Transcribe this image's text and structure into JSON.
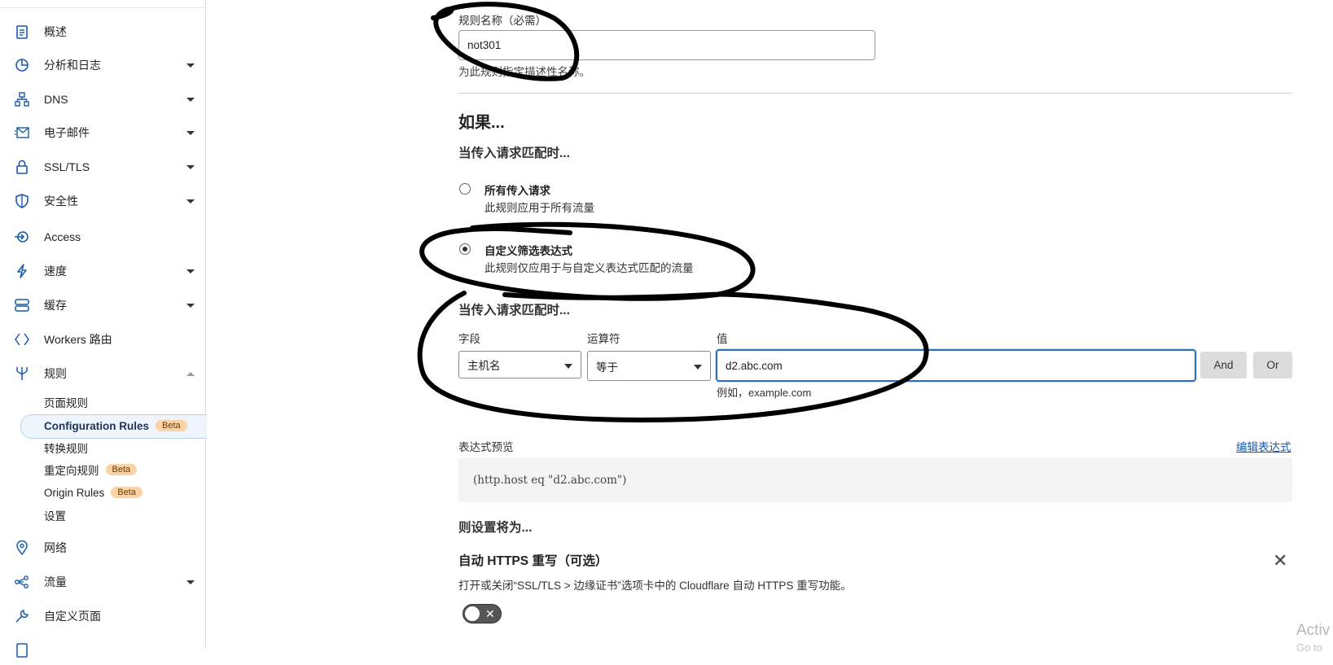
{
  "sidebar": {
    "items": [
      {
        "label": "概述",
        "icon": "clipboard-icon",
        "caret": false
      },
      {
        "label": "分析和日志",
        "icon": "pie-chart-icon",
        "caret": true
      },
      {
        "label": "DNS",
        "icon": "network-tree-icon",
        "caret": true
      },
      {
        "label": "电子邮件",
        "icon": "email-icon",
        "caret": true
      },
      {
        "label": "SSL/TLS",
        "icon": "lock-icon",
        "caret": true
      },
      {
        "label": "安全性",
        "icon": "shield-icon",
        "caret": true
      },
      {
        "label": "Access",
        "icon": "access-arrow-icon",
        "caret": false
      },
      {
        "label": "速度",
        "icon": "lightning-icon",
        "caret": true
      },
      {
        "label": "缓存",
        "icon": "server-stack-icon",
        "caret": true
      },
      {
        "label": "Workers 路由",
        "icon": "workers-icon",
        "caret": false
      },
      {
        "label": "规则",
        "icon": "fork-icon",
        "caret": "up"
      },
      {
        "label": "网络",
        "icon": "location-pin-icon",
        "caret": false
      },
      {
        "label": "流量",
        "icon": "traffic-nodes-icon",
        "caret": true
      },
      {
        "label": "自定义页面",
        "icon": "wrench-icon",
        "caret": false
      }
    ],
    "rules_sub": [
      {
        "label": "页面规则",
        "badge": ""
      },
      {
        "label": "Configuration Rules",
        "badge": "Beta",
        "active": true
      },
      {
        "label": "转换规则",
        "badge": ""
      },
      {
        "label": "重定向规则",
        "badge": "Beta"
      },
      {
        "label": "Origin Rules",
        "badge": "Beta"
      },
      {
        "label": "设置",
        "badge": ""
      }
    ]
  },
  "form": {
    "rule_name_label": "规则名称（必需）",
    "rule_name_value": "not301",
    "rule_name_hint": "为此规则指定描述性名称。",
    "if_heading": "如果...",
    "when_heading": "当传入请求匹配时...",
    "option_all_title": "所有传入请求",
    "option_all_desc": "此规则应用于所有流量",
    "option_custom_title": "自定义筛选表达式",
    "option_custom_desc": "此规则仅应用于与自定义表达式匹配的流量",
    "when_heading2": "当传入请求匹配时...",
    "field_label": "字段",
    "field_value": "主机名",
    "operator_label": "运算符",
    "operator_value": "等于",
    "value_label": "值",
    "value_value": "d2.abc.com",
    "value_hint": "例如，example.com",
    "and_button": "And",
    "or_button": "Or",
    "preview_label": "表达式预览",
    "edit_expression": "编辑表达式",
    "expression": "(http.host eq \"d2.abc.com\")",
    "then_heading": "则设置将为...",
    "https_title": "自动 HTTPS 重写（可选）",
    "https_desc": "打开或关闭“SSL/TLS > 边缘证书”选项卡中的 Cloudflare 自动 HTTPS 重写功能。",
    "https_toggle_on": false
  },
  "watermark": {
    "line1": "Activ",
    "line2": "Go to"
  },
  "colors": {
    "link": "#1a5aa8",
    "beta_badge": "#fbd3a8",
    "active_bg": "#eef4fb",
    "ink": "#000000"
  }
}
